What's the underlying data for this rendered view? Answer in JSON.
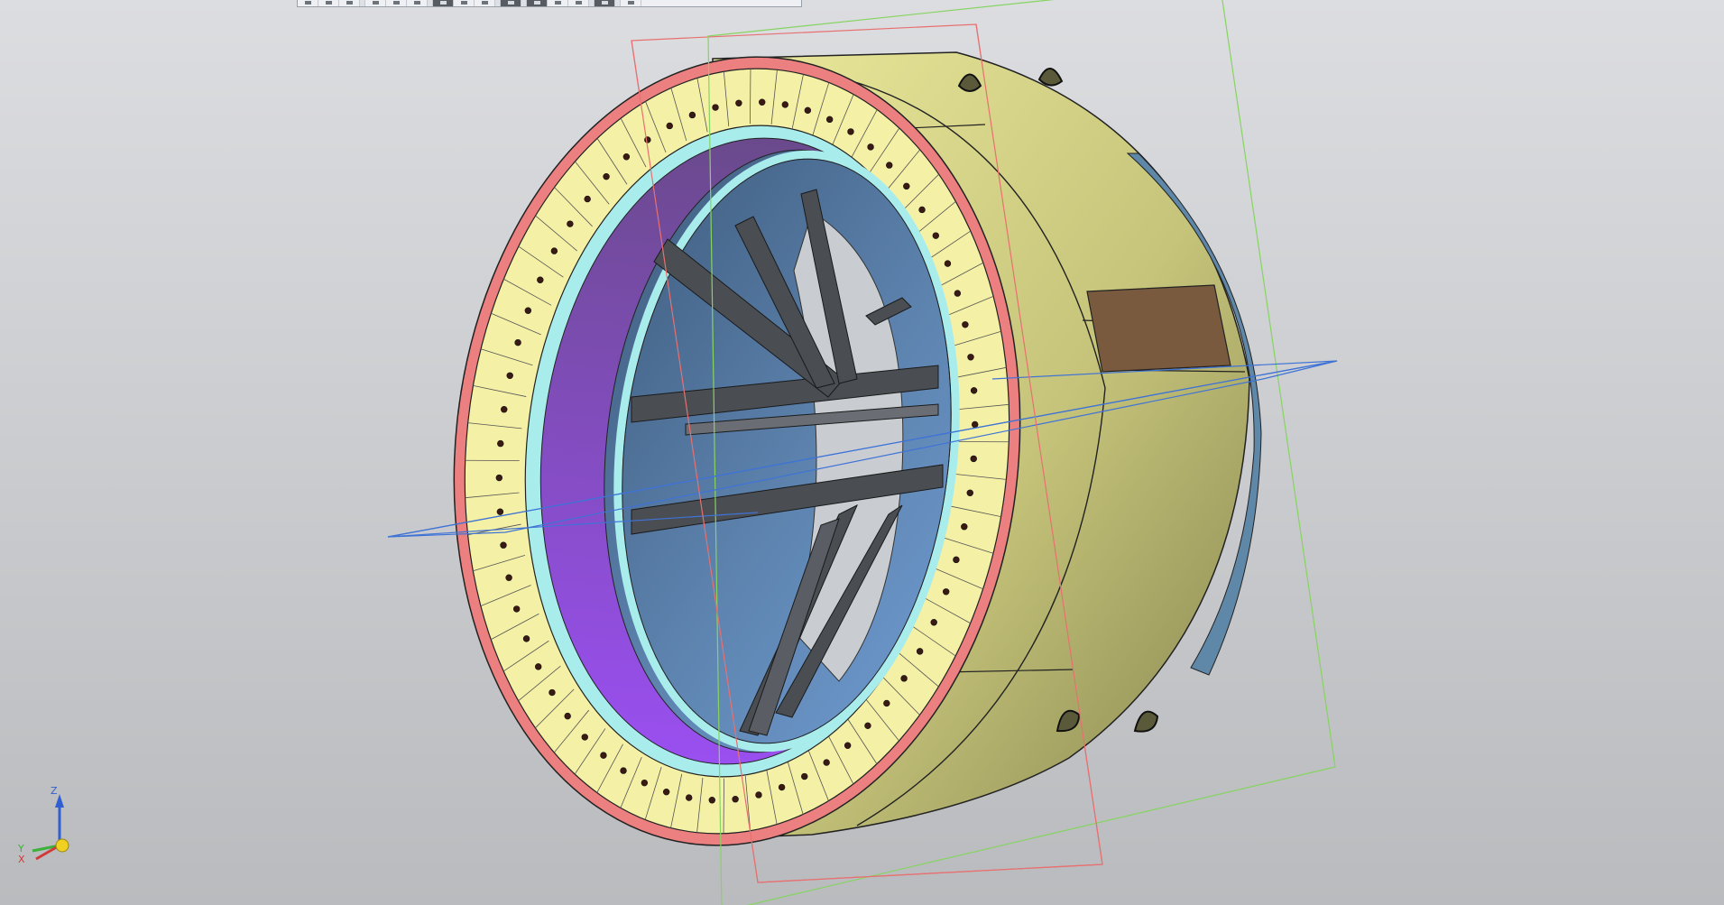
{
  "window": {
    "background_top": "#dcdde0",
    "background_bottom": "#b8babd"
  },
  "toolbar": {
    "buttons": [
      {
        "icon": "cursor-icon",
        "active": false
      },
      {
        "icon": "select-frame-icon",
        "active": false
      },
      {
        "icon": "copy-props-icon",
        "active": false
      },
      {
        "icon": "sep",
        "active": false
      },
      {
        "icon": "line-icon",
        "active": false
      },
      {
        "icon": "dash-icon",
        "active": false
      },
      {
        "icon": "arrow-icon",
        "active": false
      },
      {
        "icon": "sep",
        "active": false
      },
      {
        "icon": "shaded-icon",
        "active": true
      },
      {
        "icon": "wire-icon",
        "active": false
      },
      {
        "icon": "hidden-line-icon",
        "active": false
      },
      {
        "icon": "sep",
        "active": false
      },
      {
        "icon": "perspective-icon",
        "active": true
      },
      {
        "icon": "sep",
        "active": false
      },
      {
        "icon": "section-icon",
        "active": true
      },
      {
        "icon": "orient-icon",
        "active": false
      },
      {
        "icon": "zoom-icon",
        "active": false
      },
      {
        "icon": "sep",
        "active": false
      },
      {
        "icon": "layers-icon",
        "active": true
      },
      {
        "icon": "sep",
        "active": false
      },
      {
        "icon": "filter-icon",
        "active": false
      }
    ]
  },
  "model": {
    "colors": {
      "flange_face": "#f4f0a6",
      "flange_rim": "#ec7f7f",
      "inner_ring": "#a9ecec",
      "shell_light": "#e8e68c",
      "shell_dark": "#8a8a55",
      "brown_band": "#7a5a3e",
      "strut": "#4a4d52",
      "interior_blue": "#4e6f92",
      "interior_purple": "#7b46a8"
    }
  },
  "planes": {
    "xy_color": "#3a6fd0",
    "xz_color": "#e86a6a",
    "yz_color": "#7ad04a"
  },
  "triad": {
    "z_label": "Z",
    "y_label": "Y",
    "x_label": "X"
  }
}
